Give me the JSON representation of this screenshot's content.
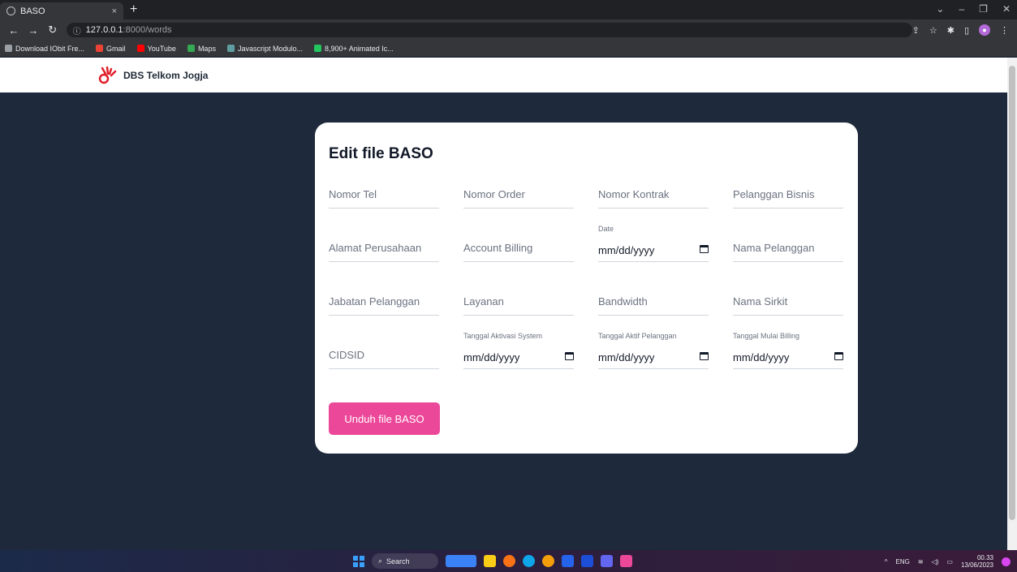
{
  "browser": {
    "tab_title": "BASO",
    "tab_close": "×",
    "new_tab": "+",
    "url_host": "127.0.0.1",
    "url_path": ":8000/words",
    "bookmarks": [
      {
        "label": "Download IObit Fre...",
        "color": "#9aa0a6"
      },
      {
        "label": "Gmail",
        "color": "#ea4335"
      },
      {
        "label": "YouTube",
        "color": "#ff0000"
      },
      {
        "label": "Maps",
        "color": "#34a853"
      },
      {
        "label": "Javascript Modulo...",
        "color": "#5f9ea0"
      },
      {
        "label": "8,900+ Animated Ic...",
        "color": "#22c55e"
      }
    ]
  },
  "app": {
    "brand": "DBS Telkom Jogja"
  },
  "form": {
    "title": "Edit file BASO",
    "fields": {
      "nomor_tel": "Nomor Tel",
      "nomor_order": "Nomor Order",
      "nomor_kontrak": "Nomor Kontrak",
      "pelanggan_bisnis": "Pelanggan Bisnis",
      "alamat_perusahaan": "Alamat Perusahaan",
      "account_billing": "Account Billing",
      "date_label": "Date",
      "date_value": "mm/dd/yyyy",
      "nama_pelanggan": "Nama Pelanggan",
      "jabatan_pelanggan": "Jabatan Pelanggan",
      "layanan": "Layanan",
      "bandwidth": "Bandwidth",
      "nama_sirkit": "Nama Sirkit",
      "cidsid": "CIDSID",
      "tgl_aktivasi_label": "Tanggal Aktivasi System",
      "tgl_aktivasi_value": "mm/dd/yyyy",
      "tgl_aktif_label": "Tanggal Aktif Pelanggan",
      "tgl_aktif_value": "mm/dd/yyyy",
      "tgl_billing_label": "Tanggal Mulai Billing",
      "tgl_billing_value": "mm/dd/yyyy"
    },
    "submit_label": "Unduh file BASO"
  },
  "taskbar": {
    "search_label": "Search",
    "lang": "ENG",
    "time": "00.33",
    "date": "13/06/2023"
  }
}
